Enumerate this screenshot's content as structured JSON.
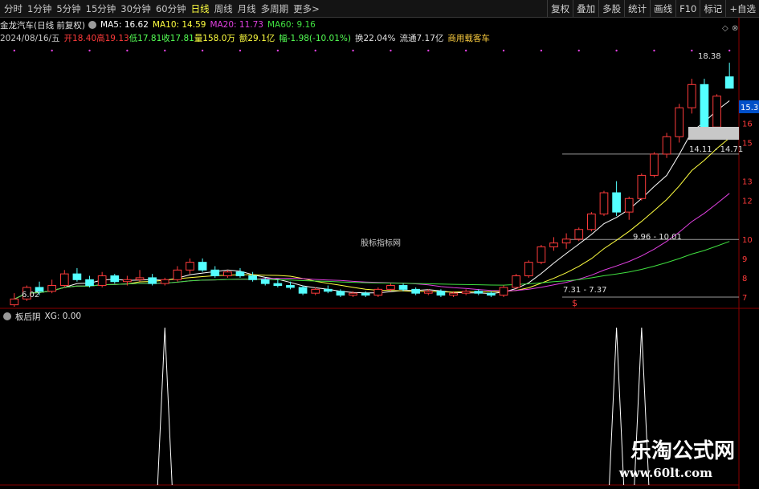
{
  "toolbar": {
    "periods": [
      "分时",
      "1分钟",
      "5分钟",
      "15分钟",
      "30分钟",
      "60分钟",
      "日线",
      "周线",
      "月线",
      "多周期",
      "更多>"
    ],
    "active_period": "日线",
    "tools": [
      "复权",
      "叠加",
      "多股",
      "统计",
      "画线",
      "F10",
      "标记",
      "+自选"
    ]
  },
  "stock": {
    "name": "金龙汽车",
    "mode": "(日线 前复权)",
    "ma5": "MA5: 16.62",
    "ma10": "MA10: 14.59",
    "ma20": "MA20: 11.73",
    "ma60": "MA60: 9.16",
    "date": "2024/08/16/五",
    "open": "开18.40",
    "high": "高19.13",
    "low": "低17.81",
    "close": "收17.81",
    "volume": "量158.0万",
    "amount": "额29.1亿",
    "change": "幅-1.98(-10.01%)",
    "turnover": "换22.04%",
    "float_cap": "流通7.17亿",
    "sector": "商用载客车"
  },
  "chart_data": {
    "type": "candlestick",
    "price_axis": {
      "ylim": [
        6.5,
        19.8
      ],
      "labels": [
        "16",
        "15",
        "13",
        "12",
        "10",
        "9",
        "8",
        "7"
      ],
      "current_price_tag": "15.3"
    },
    "ohlc": [
      [
        6.6,
        7.2,
        6.5,
        6.9
      ],
      [
        6.9,
        7.6,
        6.8,
        7.5
      ],
      [
        7.5,
        7.8,
        7.1,
        7.3
      ],
      [
        7.3,
        7.9,
        7.2,
        7.6
      ],
      [
        7.6,
        8.4,
        7.5,
        8.2
      ],
      [
        8.2,
        8.5,
        7.8,
        7.9
      ],
      [
        7.9,
        8.1,
        7.5,
        7.6
      ],
      [
        7.6,
        8.3,
        7.5,
        8.1
      ],
      [
        8.1,
        8.2,
        7.7,
        7.8
      ],
      [
        7.8,
        8.1,
        7.6,
        7.9
      ],
      [
        7.9,
        8.4,
        7.8,
        8.0
      ],
      [
        8.0,
        8.2,
        7.6,
        7.7
      ],
      [
        7.7,
        8.0,
        7.6,
        7.9
      ],
      [
        7.9,
        8.6,
        7.8,
        8.4
      ],
      [
        8.4,
        9.0,
        8.2,
        8.8
      ],
      [
        8.8,
        9.0,
        8.3,
        8.4
      ],
      [
        8.4,
        8.6,
        8.0,
        8.1
      ],
      [
        8.1,
        8.4,
        8.0,
        8.3
      ],
      [
        8.3,
        8.5,
        8.0,
        8.1
      ],
      [
        8.1,
        8.3,
        7.8,
        7.9
      ],
      [
        7.9,
        8.0,
        7.6,
        7.7
      ],
      [
        7.7,
        7.9,
        7.5,
        7.6
      ],
      [
        7.6,
        7.8,
        7.4,
        7.5
      ],
      [
        7.5,
        7.6,
        7.1,
        7.2
      ],
      [
        7.2,
        7.5,
        7.1,
        7.4
      ],
      [
        7.4,
        7.6,
        7.2,
        7.3
      ],
      [
        7.3,
        7.4,
        7.0,
        7.1
      ],
      [
        7.1,
        7.3,
        7.0,
        7.2
      ],
      [
        7.2,
        7.3,
        7.0,
        7.1
      ],
      [
        7.1,
        7.5,
        7.0,
        7.4
      ],
      [
        7.4,
        7.7,
        7.3,
        7.6
      ],
      [
        7.6,
        7.7,
        7.3,
        7.4
      ],
      [
        7.4,
        7.5,
        7.1,
        7.2
      ],
      [
        7.2,
        7.4,
        7.1,
        7.3
      ],
      [
        7.3,
        7.4,
        7.0,
        7.1
      ],
      [
        7.1,
        7.3,
        7.0,
        7.2
      ],
      [
        7.2,
        7.4,
        7.1,
        7.3
      ],
      [
        7.3,
        7.4,
        7.1,
        7.2
      ],
      [
        7.2,
        7.3,
        7.0,
        7.1
      ],
      [
        7.1,
        7.6,
        7.0,
        7.5
      ],
      [
        7.5,
        8.2,
        7.4,
        8.1
      ],
      [
        8.1,
        8.9,
        8.0,
        8.8
      ],
      [
        8.8,
        9.7,
        8.7,
        9.6
      ],
      [
        9.6,
        10.1,
        9.4,
        9.8
      ],
      [
        9.8,
        10.3,
        9.5,
        10.0
      ],
      [
        10.0,
        10.6,
        9.9,
        10.5
      ],
      [
        10.5,
        11.4,
        10.4,
        11.3
      ],
      [
        11.3,
        12.5,
        11.2,
        12.4
      ],
      [
        12.4,
        13.0,
        11.2,
        11.4
      ],
      [
        11.4,
        12.2,
        11.0,
        12.1
      ],
      [
        12.1,
        13.4,
        12.0,
        13.3
      ],
      [
        13.3,
        14.5,
        13.2,
        14.4
      ],
      [
        14.4,
        15.5,
        14.2,
        15.3
      ],
      [
        15.3,
        17.0,
        15.0,
        16.8
      ],
      [
        16.8,
        18.3,
        16.5,
        18.0
      ],
      [
        18.0,
        18.3,
        15.5,
        15.8
      ],
      [
        15.8,
        17.5,
        15.6,
        17.4
      ],
      [
        18.4,
        19.13,
        17.81,
        17.81
      ]
    ],
    "annotations": [
      "6.02",
      "7.31 - 7.37",
      "9.96 - 10.01",
      "14.11 - 14.71",
      "18.38"
    ],
    "watermark": "股标指标网",
    "indicator": {
      "name": "板后阴",
      "label": "XG: 0.00",
      "spikes_at_index": [
        12,
        48,
        50
      ]
    }
  },
  "watermark": {
    "title": "乐淘公式网",
    "url": "www.60lt.com"
  },
  "colors": {
    "up": "#ff3b3b",
    "down": "#54ffff",
    "ma5": "#ffffff",
    "ma10": "#ffff40",
    "ma20": "#e040e0",
    "ma60": "#40e040",
    "accent": "#ffff40"
  }
}
